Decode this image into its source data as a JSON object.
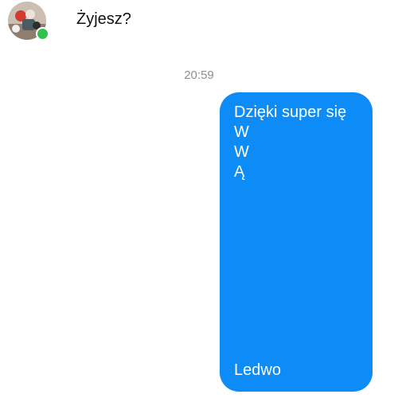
{
  "chat": {
    "incoming_message": "Żyjesz?",
    "timestamp": "20:59",
    "outgoing_lines": [
      "Dzięki super się",
      "W",
      "W",
      "Ą",
      "Ledwo"
    ]
  },
  "colors": {
    "outgoing_bubble": "#0d8cf7",
    "online_status": "#31c24d",
    "timestamp_text": "#8e8e93"
  },
  "icons": {
    "avatar": "profile-photo",
    "status": "online-dot"
  }
}
